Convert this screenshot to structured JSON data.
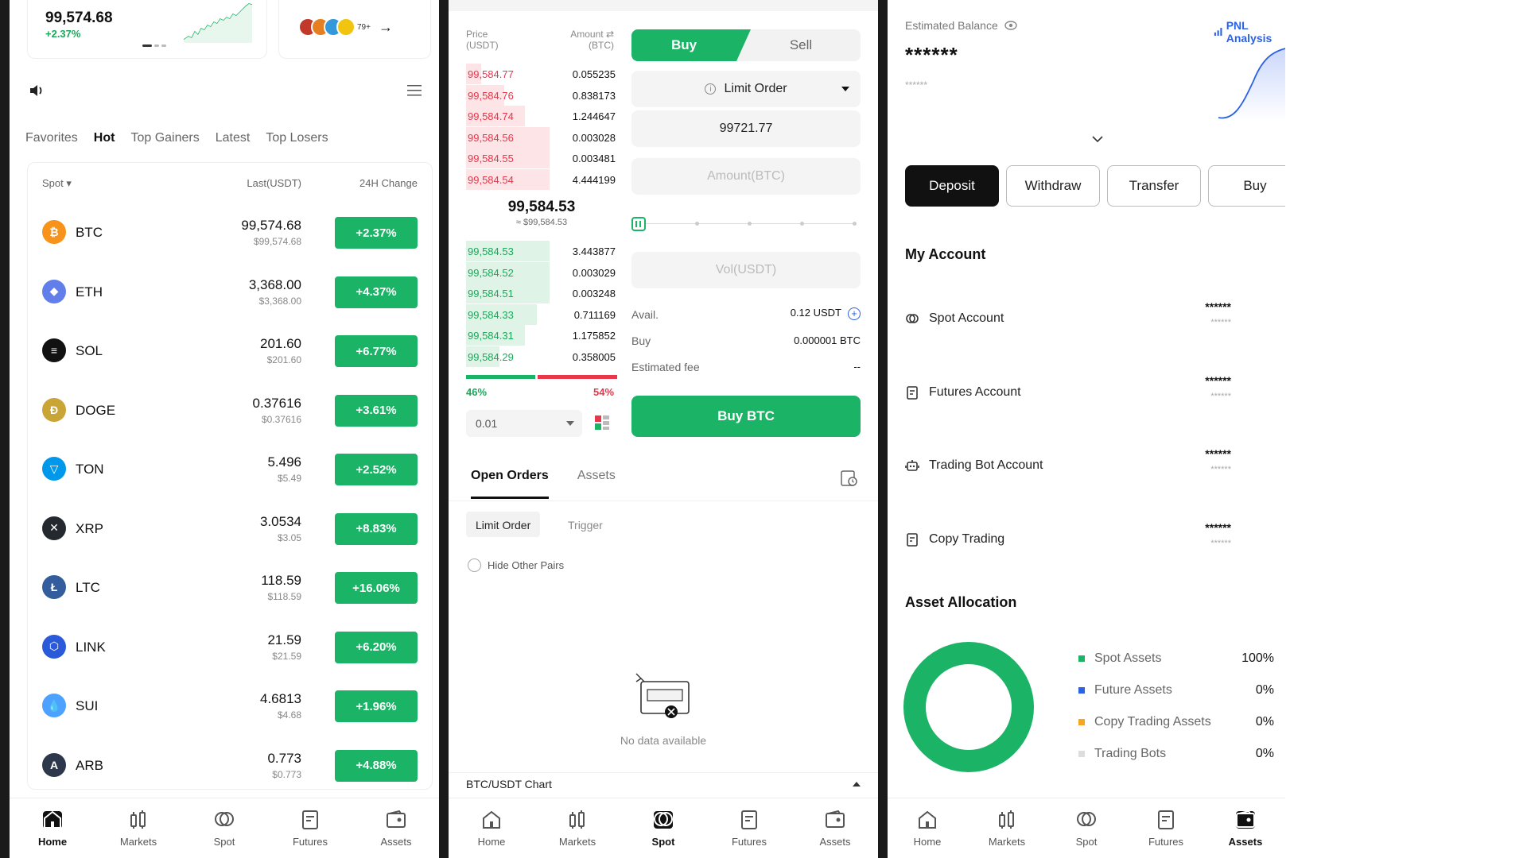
{
  "market": {
    "top_price": "99,574.68",
    "top_change": "+2.37%",
    "avatar_count": "79+",
    "tabs": [
      {
        "label": "Favorites"
      },
      {
        "label": "Hot"
      },
      {
        "label": "Top Gainers"
      },
      {
        "label": "Latest"
      },
      {
        "label": "Top Losers"
      }
    ],
    "active_tab": "Hot",
    "header": {
      "spot": "Spot",
      "last": "Last(USDT)",
      "change": "24H Change"
    },
    "coins": [
      {
        "symbol": "BTC",
        "price": "99,574.68",
        "usd": "$99,574.68",
        "change": "+2.37%",
        "icon_color": "#f7931a",
        "icon": "bitcoin-icon",
        "glyph": "₿"
      },
      {
        "symbol": "ETH",
        "price": "3,368.00",
        "usd": "$3,368.00",
        "change": "+4.37%",
        "icon_color": "#627eea",
        "icon": "ethereum-icon",
        "glyph": "◆"
      },
      {
        "symbol": "SOL",
        "price": "201.60",
        "usd": "$201.60",
        "change": "+6.77%",
        "icon_color": "#111111",
        "icon": "solana-icon",
        "glyph": "≡"
      },
      {
        "symbol": "DOGE",
        "price": "0.37616",
        "usd": "$0.37616",
        "change": "+3.61%",
        "icon_color": "#c9a537",
        "icon": "dogecoin-icon",
        "glyph": "Ð"
      },
      {
        "symbol": "TON",
        "price": "5.496",
        "usd": "$5.49",
        "change": "+2.52%",
        "icon_color": "#0098ea",
        "icon": "toncoin-icon",
        "glyph": "▽"
      },
      {
        "symbol": "XRP",
        "price": "3.0534",
        "usd": "$3.05",
        "change": "+8.83%",
        "icon_color": "#23292f",
        "icon": "xrp-icon",
        "glyph": "✕"
      },
      {
        "symbol": "LTC",
        "price": "118.59",
        "usd": "$118.59",
        "change": "+16.06%",
        "icon_color": "#345d9d",
        "icon": "litecoin-icon",
        "glyph": "Ł"
      },
      {
        "symbol": "LINK",
        "price": "21.59",
        "usd": "$21.59",
        "change": "+6.20%",
        "icon_color": "#2a5ada",
        "icon": "chainlink-icon",
        "glyph": "⬡"
      },
      {
        "symbol": "SUI",
        "price": "4.6813",
        "usd": "$4.68",
        "change": "+1.96%",
        "icon_color": "#4da2ff",
        "icon": "sui-icon",
        "glyph": "💧"
      },
      {
        "symbol": "ARB",
        "price": "0.773",
        "usd": "$0.773",
        "change": "+4.88%",
        "icon_color": "#2d374b",
        "icon": "arbitrum-icon",
        "glyph": "A"
      }
    ]
  },
  "nav": [
    {
      "label": "Home",
      "icon": "home-icon"
    },
    {
      "label": "Markets",
      "icon": "markets-icon"
    },
    {
      "label": "Spot",
      "icon": "spot-icon"
    },
    {
      "label": "Futures",
      "icon": "futures-icon"
    },
    {
      "label": "Assets",
      "icon": "assets-icon"
    }
  ],
  "spot": {
    "ob_head": {
      "price": "Price",
      "price_unit": "(USDT)",
      "amount": "Amount ⇄",
      "amount_unit": "(BTC)"
    },
    "asks": [
      {
        "price": "99,584.77",
        "amount": "0.055235",
        "depth": 0.18
      },
      {
        "price": "99,584.76",
        "amount": "0.838173",
        "depth": 0.45
      },
      {
        "price": "99,584.74",
        "amount": "1.244647",
        "depth": 0.7
      },
      {
        "price": "99,584.56",
        "amount": "0.003028",
        "depth": 1.0
      },
      {
        "price": "99,584.55",
        "amount": "0.003481",
        "depth": 1.0
      },
      {
        "price": "99,584.54",
        "amount": "4.444199",
        "depth": 1.0
      }
    ],
    "mid_price": "99,584.53",
    "mid_usd": "≈ $99,584.53",
    "bids": [
      {
        "price": "99,584.53",
        "amount": "3.443877",
        "depth": 1.0
      },
      {
        "price": "99,584.52",
        "amount": "0.003029",
        "depth": 1.0
      },
      {
        "price": "99,584.51",
        "amount": "0.003248",
        "depth": 1.0
      },
      {
        "price": "99,584.33",
        "amount": "0.711169",
        "depth": 0.85
      },
      {
        "price": "99,584.31",
        "amount": "1.175852",
        "depth": 0.7
      },
      {
        "price": "99,584.29",
        "amount": "0.358005",
        "depth": 0.4
      }
    ],
    "buy_pct": "46%",
    "sell_pct": "54%",
    "step": "0.01",
    "buy_tab": "Buy",
    "sell_tab": "Sell",
    "order_type": "Limit Order",
    "price_value": "99721.77",
    "amount_placeholder": "Amount(BTC)",
    "vol_placeholder": "Vol(USDT)",
    "avail_label": "Avail.",
    "avail_value": "0.12 USDT",
    "buy_label": "Buy",
    "buy_value": "0.000001 BTC",
    "fee_label": "Estimated fee",
    "fee_value": "--",
    "buy_button": "Buy BTC",
    "tabs": [
      {
        "label": "Open Orders"
      },
      {
        "label": "Assets"
      }
    ],
    "chips": [
      {
        "label": "Limit Order"
      },
      {
        "label": "Trigger"
      }
    ],
    "hide_pairs": "Hide Other Pairs",
    "empty": "No data available",
    "chart_label": "BTC/USDT Chart"
  },
  "assets": {
    "est_label": "Estimated Balance",
    "pnl": "PNL Analysis",
    "balance_mask": "******",
    "balance_sub": "******",
    "actions": [
      {
        "label": "Deposit"
      },
      {
        "label": "Withdraw"
      },
      {
        "label": "Transfer"
      },
      {
        "label": "Buy"
      }
    ],
    "my_account": "My Account",
    "accounts": [
      {
        "name": "Spot Account",
        "mask": "******",
        "mask2": "******",
        "icon": "spot-account-icon"
      },
      {
        "name": "Futures Account",
        "mask": "******",
        "mask2": "******",
        "icon": "futures-account-icon"
      },
      {
        "name": "Trading Bot Account",
        "mask": "******",
        "mask2": "******",
        "icon": "bot-icon"
      },
      {
        "name": "Copy Trading",
        "mask": "******",
        "mask2": "******",
        "icon": "copy-trading-icon"
      }
    ],
    "allocation_title": "Asset Allocation",
    "allocation": [
      {
        "name": "Spot Assets",
        "pct": "100%",
        "color": "#1bb365",
        "value": 100
      },
      {
        "name": "Future Assets",
        "pct": "0%",
        "color": "#2a62e6",
        "value": 0
      },
      {
        "name": "Copy Trading Assets",
        "pct": "0%",
        "color": "#f5a623",
        "value": 0
      },
      {
        "name": "Trading Bots",
        "pct": "0%",
        "color": "#dddddd",
        "value": 0
      }
    ]
  }
}
